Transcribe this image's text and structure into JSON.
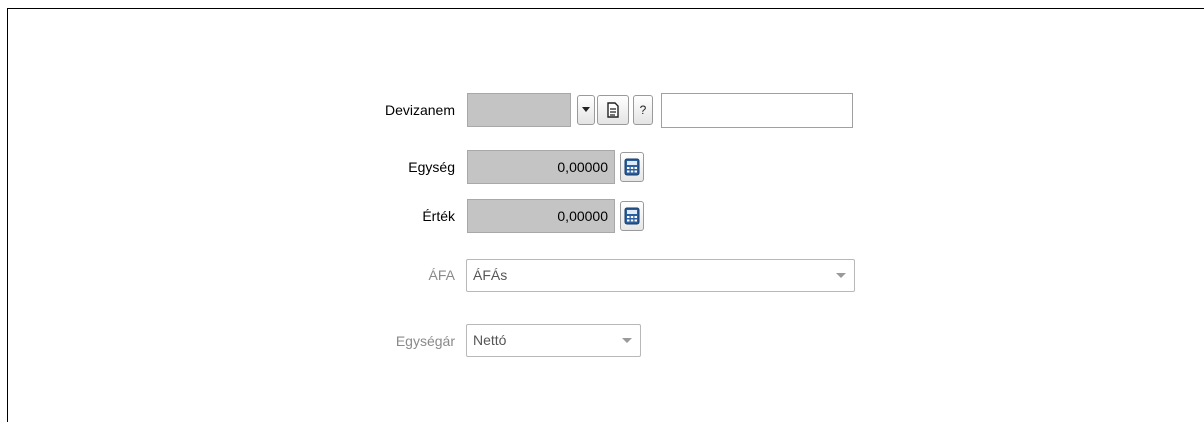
{
  "form": {
    "devizanem_label": "Devizanem",
    "devizanem_value": "",
    "devizanem_text": "",
    "egyseg_label": "Egység",
    "egyseg_value": "0,00000",
    "ertek_label": "Érték",
    "ertek_value": "0,00000",
    "afa_label": "ÁFA",
    "afa_selected": "ÁFÁs",
    "egysegar_label": "Egységár",
    "egysegar_selected": "Nettó",
    "help_glyph": "?"
  },
  "icons": {
    "dropdown": "chevron-down-icon",
    "document": "document-icon",
    "help": "question-icon",
    "calculator": "calculator-icon"
  },
  "colors": {
    "disabled_field": "#c4c4c4",
    "disabled_text": "#8a8a8a"
  }
}
